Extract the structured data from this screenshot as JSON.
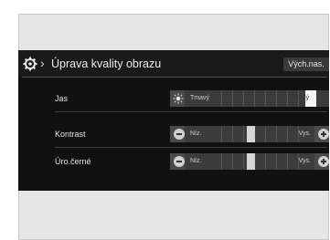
{
  "header": {
    "title": "Úprava kvality obrazu",
    "default_button": "Vých.nas."
  },
  "settings": [
    {
      "label": "Jas",
      "min_label": "Tmavý",
      "max_label": "Světlý",
      "value": 0.96
    },
    {
      "label": "Kontrast",
      "min_label": "Níz.",
      "max_label": "Vys.",
      "value": 0.5
    },
    {
      "label": "Úro.černé",
      "min_label": "Níz.",
      "max_label": "Vys.",
      "value": 0.5
    }
  ],
  "colors": {
    "screen_bg": "#111111",
    "frame_bg": "#e6e6e6",
    "slider_bg": "#3c3c3c"
  },
  "icons": [
    "gear-icon",
    "chevron-right-icon",
    "sun-icon",
    "minus-icon",
    "plus-icon"
  ]
}
